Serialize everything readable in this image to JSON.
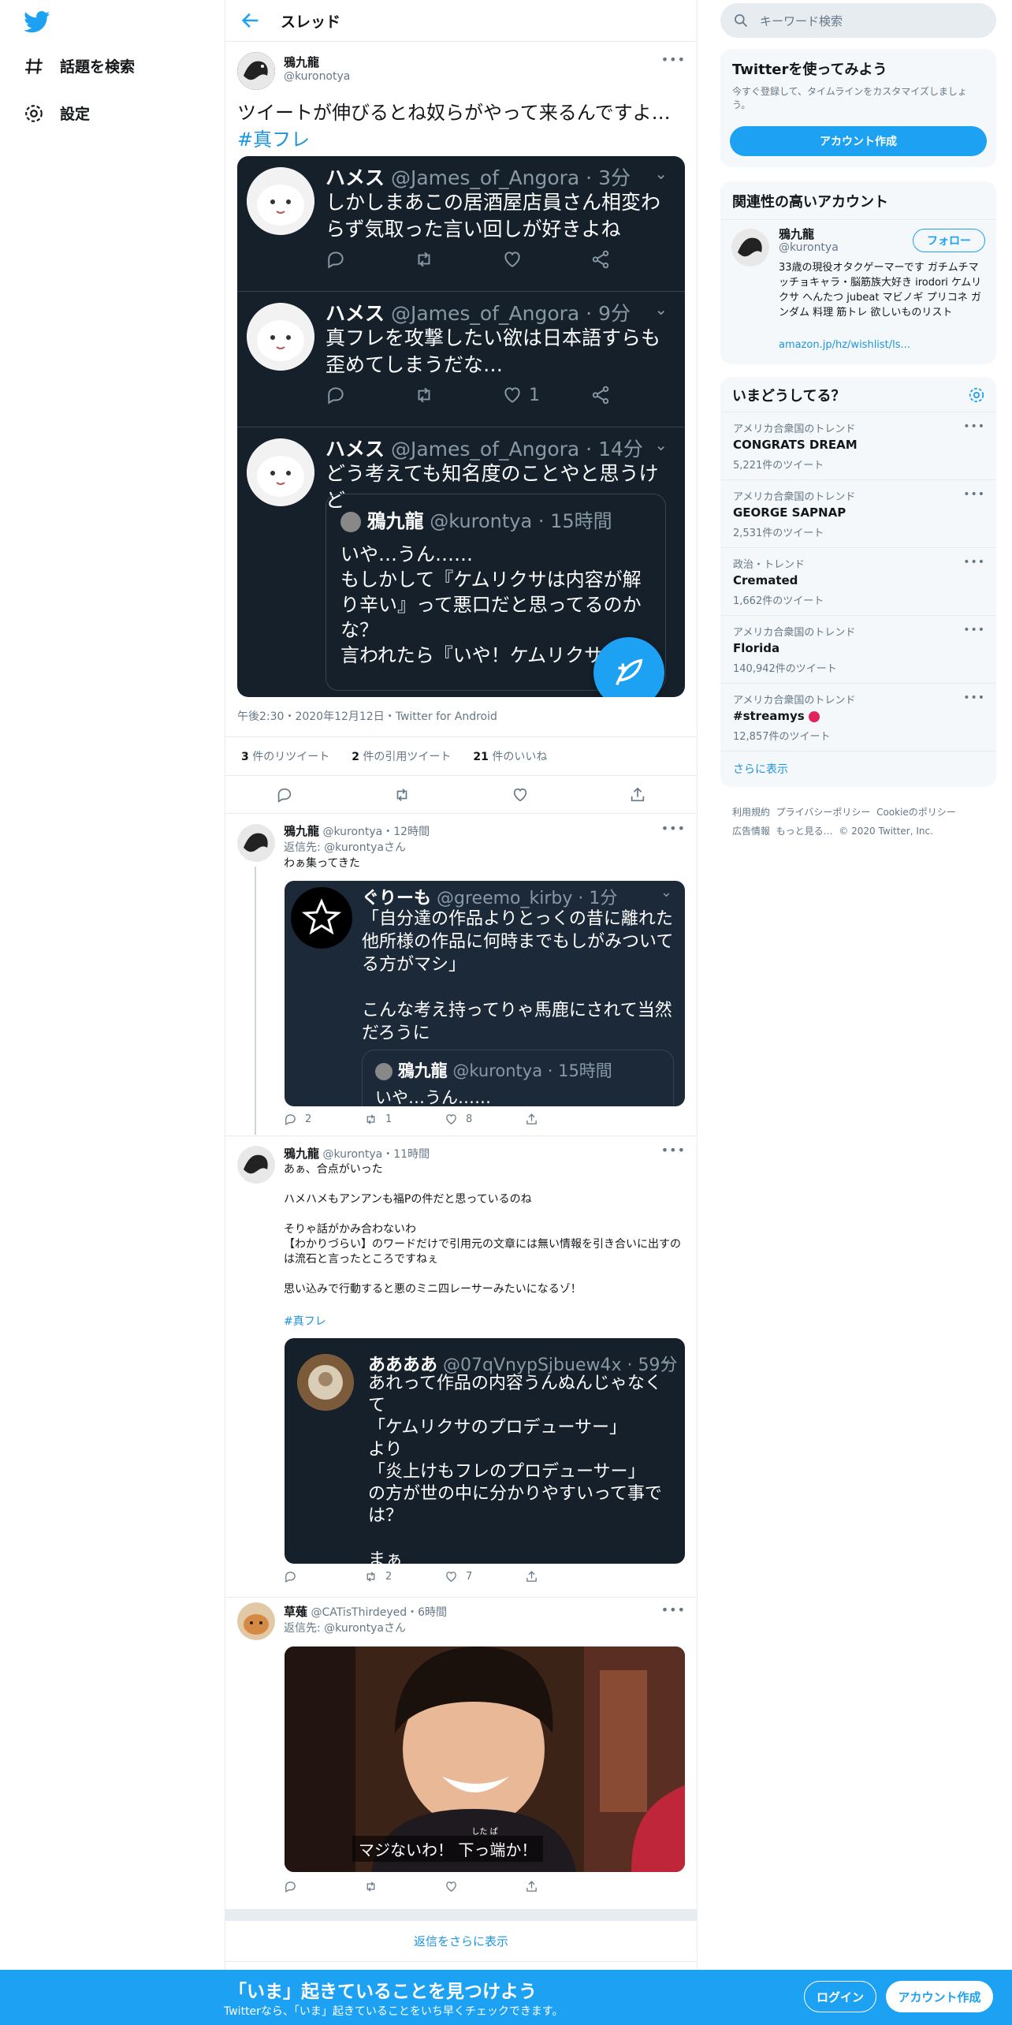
{
  "nav": {
    "explore": "話題を検索",
    "settings": "設定"
  },
  "header": {
    "title": "スレッド"
  },
  "main_tweet": {
    "name": "鴉九龍",
    "handle": "@kuronotya",
    "text": "ツイートが伸びるとね奴らがやって来るんですよ…",
    "hashtag": "#真フレ",
    "meta": "午後2:30・2020年12月12日・Twitter for Android",
    "stats": {
      "retweets_n": "3",
      "retweets_l": "件のリツイート",
      "quotes_n": "2",
      "quotes_l": "件の引用ツイート",
      "likes_n": "21",
      "likes_l": "件のいいね"
    }
  },
  "embed": {
    "tweets": [
      {
        "name": "ハメス",
        "meta": "@James_of_Angora · 3分",
        "text": "しかしまあこの居酒屋店員さん相変わらず気取った言い回しが好きよね",
        "likes": ""
      },
      {
        "name": "ハメス",
        "meta": "@James_of_Angora · 9分",
        "text": "真フレを攻撃したい欲は日本語すらも歪めてしまうだな…",
        "likes": "1"
      },
      {
        "name": "ハメス",
        "meta": "@James_of_Angora · 14分",
        "text": "どう考えても知名度のことやと思うけど",
        "likes": ""
      }
    ],
    "quote": {
      "name": "鴉九龍",
      "meta": "@kurontya · 15時間",
      "text": "いや…うん……\nもしかして『ケムリクサは内容が解り辛い』って悪口だと思ってるのかな？\n言われたら『いや！ケムリクサ"
    }
  },
  "replies": [
    {
      "name": "鴉九龍",
      "meta": "@kurontya・12時間",
      "reply_to_label": "返信先: ",
      "reply_to": "@kurontya",
      "reply_to_suffix": "さん",
      "text": "わぁ集ってきた",
      "embed": {
        "name": "ぐりーも",
        "meta": "@greemo_kirby · 1分",
        "text": "「自分達の作品よりとっくの昔に離れた他所様の作品に何時までもしがみついてる方がマシ」\n\nこんな考え持ってりゃ馬鹿にされて当然だろうに",
        "quote_name": "鴉九龍",
        "quote_meta": "@kurontya · 15時間",
        "quote_text": "いや…うん……"
      },
      "counts": {
        "reply": "2",
        "retweet": "1",
        "like": "8"
      }
    },
    {
      "name": "鴉九龍",
      "meta": "@kurontya・11時間",
      "text": "あぁ、合点がいった\n\nハメハメもアンアンも福Pの件だと思っているのね\n\nそりゃ話がかみ合わないわ\n【わかりづらい】のワードだけで引用元の文章には無い情報を引き合いに出すのは流石と言ったところですねぇ\n\n思い込みで行動すると悪のミニ四レーサーみたいになるゾ！",
      "hashtag": "#真フレ",
      "embed": {
        "name": "ああああ",
        "meta": "@07qVnypSjbuew4x · 59分",
        "text": "あれって作品の内容うんぬんじゃなくて\n「ケムリクサのプロデューサー」\nより\n「炎上けもフレのプロデューサー」\nの方が世の中に分かりやすいって事では？\n\nまぁ\nケムリクサに対する作品愛より"
      },
      "counts": {
        "reply": "",
        "retweet": "2",
        "like": "7"
      }
    },
    {
      "name": "草薙",
      "meta": "@CATisThirdeyed・6時間",
      "reply_to_label": "返信先: ",
      "reply_to": "@kurontya",
      "reply_to_suffix": "さん",
      "caption": "マジないわ！ 下っ端か！",
      "ruby": "した ぱ"
    }
  ],
  "show_more": "返信をさらに表示",
  "sidebar": {
    "search_placeholder": "キーワード検索",
    "signup": {
      "title": "Twitterを使ってみよう",
      "desc": "今すぐ登録して、タイムラインをカスタマイズしましょう。",
      "button": "アカウント作成"
    },
    "relevant": {
      "title": "関連性の高いアカウント",
      "name": "鴉九龍",
      "handle": "@kurontya",
      "follow": "フォロー",
      "bio": "33歳の現役オタクゲーマーです ガチムチマッチョキャラ・脳筋族大好き irodori ケムリクサ へんたつ jubeat マビノギ プリコネ ガンダム 料理 筋トレ 欲しいものリスト",
      "link": "amazon.jp/hz/wishlist/ls..."
    },
    "trends": {
      "title": "いまどうしてる？",
      "items": [
        {
          "cat": "アメリカ合衆国のトレンド",
          "name": "CONGRATS DREAM",
          "count": "5,221件のツイート"
        },
        {
          "cat": "アメリカ合衆国のトレンド",
          "name": "GEORGE SAPNAP",
          "count": "2,531件のツイート"
        },
        {
          "cat": "政治・トレンド",
          "name": "Cremated",
          "count": "1,662件のツイート"
        },
        {
          "cat": "アメリカ合衆国のトレンド",
          "name": "Florida",
          "count": "140,942件のツイート"
        },
        {
          "cat": "アメリカ合衆国のトレンド",
          "name": "#streamys",
          "count": "12,857件のツイート"
        }
      ],
      "more": "さらに表示"
    },
    "footer_links": [
      "利用規約",
      "プライバシーポリシー",
      "Cookieのポリシー",
      "広告情報",
      "もっと見る…",
      "© 2020 Twitter, Inc."
    ]
  },
  "bottom_bar": {
    "title": "「いま」起きていることを見つけよう",
    "sub": "Twitterなら、「いま」起きていることをいち早くチェックできます。",
    "login": "ログイン",
    "signup": "アカウント作成"
  },
  "colors": {
    "accent": "#1da1f2",
    "dark_card": "#15202b"
  }
}
